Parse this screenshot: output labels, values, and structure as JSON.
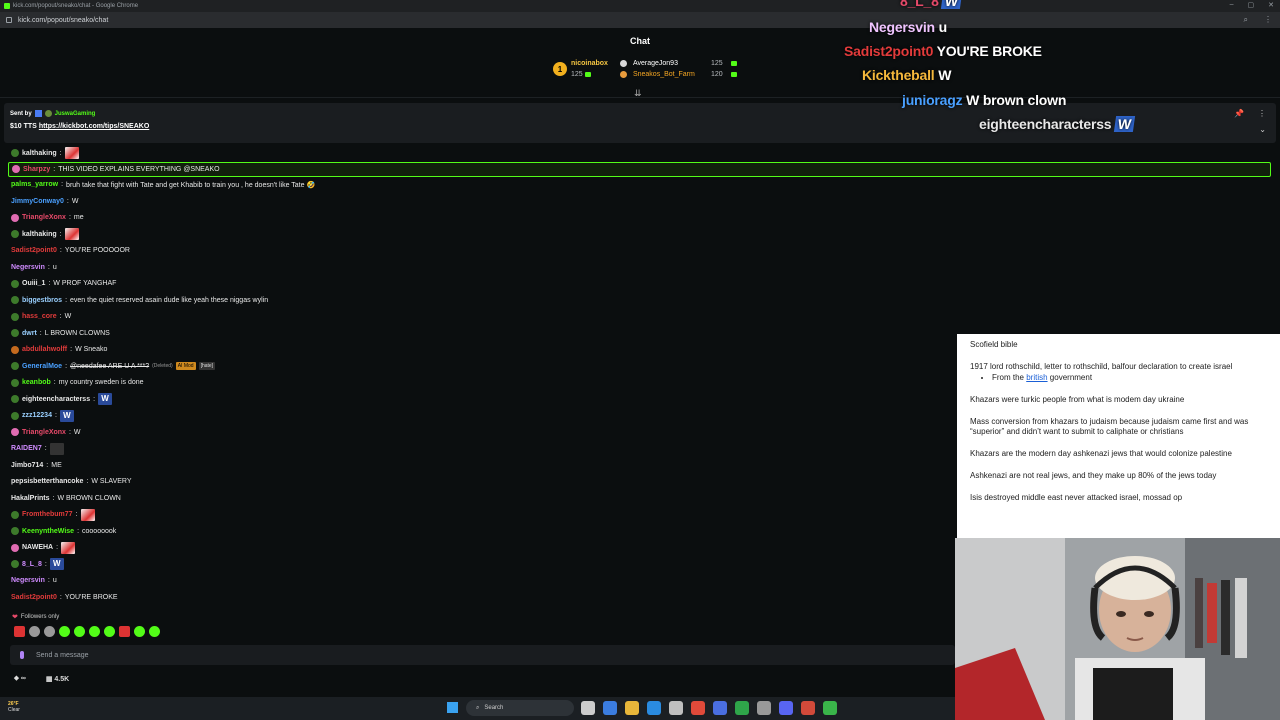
{
  "browser": {
    "title": "kick.com/popout/sneako/chat - Google Chrome",
    "url": "kick.com/popout/sneako/chat"
  },
  "chat": {
    "title": "Chat",
    "leaderboard_top": {
      "rank": "1",
      "name": "nicoinabox",
      "points": "125"
    },
    "leaderboard_rows": [
      {
        "name": "AverageJon93",
        "points": "125"
      },
      {
        "name": "Sneakos_Bot_Farm",
        "points": "120"
      }
    ],
    "pinned": {
      "sent_by_label": "Sent by",
      "user": "JuswaGaming",
      "text_prefix": "$10 TTS",
      "link": "https://kickbot.com/tips/SNEAKO"
    }
  },
  "messages": [
    {
      "user": "kalthaking",
      "color": "#e8e8e8",
      "text": "",
      "emote": "img",
      "badge": "green"
    },
    {
      "user": "Sharpzy",
      "color": "#e84a6a",
      "text": "THIS VIDEO EXPLAINS EVERYTHING @SNEAKO",
      "badge": "pink",
      "highlight": true
    },
    {
      "user": "palms_yarrow",
      "color": "#53fc18",
      "text": "bruh take that fight with Tate and get Khabib to train you , he doesn't like Tate 🤣"
    },
    {
      "user": "JimmyConway0",
      "color": "#4aa0ff",
      "text": "W"
    },
    {
      "user": "TriangleXonx",
      "color": "#e84a6a",
      "text": "me",
      "badge": "pink"
    },
    {
      "user": "kalthaking",
      "color": "#e8e8e8",
      "text": "",
      "emote": "img",
      "badge": "green"
    },
    {
      "user": "Sadist2point0",
      "color": "#e23b3b",
      "text": "YOU'RE POOOOOR"
    },
    {
      "user": "Negersvin",
      "color": "#d08cff",
      "text": "u"
    },
    {
      "user": "Ouiii_1",
      "color": "#e8e8e8",
      "text": "W PROF YANGHAF",
      "badge": "green"
    },
    {
      "user": "biggestbros",
      "color": "#9ad0ff",
      "text": "even the quiet reserved asain dude like yeah these niggas wylin",
      "badge": "green"
    },
    {
      "user": "hass_core",
      "color": "#e23b3b",
      "text": "W",
      "badge": "green"
    },
    {
      "user": "dwrt",
      "color": "#9ad0ff",
      "text": "L BROWN CLOWNS",
      "badge": "green"
    },
    {
      "user": "abdullahwolff",
      "color": "#e23b3b",
      "text": "W Sneako",
      "badge": "orange"
    },
    {
      "user": "GeneralMoe",
      "color": "#4aa0ff",
      "text": "@needafee ARE U A ***?",
      "deleted": "(Deleted)",
      "chip": "AI Mod",
      "chip2": "[hate]",
      "badge": "green"
    },
    {
      "user": "keanbob",
      "color": "#53fc18",
      "text": "my country sweden is done",
      "badge": "green"
    },
    {
      "user": "eighteencharacterss",
      "color": "#e8e8e8",
      "text": "",
      "emote": "w",
      "badge": "green"
    },
    {
      "user": "zzz12234",
      "color": "#9ad0ff",
      "text": "",
      "emote": "w",
      "badge": "green"
    },
    {
      "user": "TriangleXonx",
      "color": "#e84a6a",
      "text": "W",
      "badge": "pink"
    },
    {
      "user": "RAIDEN7",
      "color": "#d08cff",
      "text": "",
      "emote": "dark"
    },
    {
      "user": "Jimbo714",
      "color": "#e8e8e8",
      "text": "ME"
    },
    {
      "user": "pepsisbetterthancoke",
      "color": "#e8e8e8",
      "text": "W SLAVERY"
    },
    {
      "user": "HakalPrints",
      "color": "#e8e8e8",
      "text": "W BROWN CLOWN"
    },
    {
      "user": "Fromthebum77",
      "color": "#e23b3b",
      "text": "",
      "emote": "img",
      "badge": "green"
    },
    {
      "user": "KeenyntheWise",
      "color": "#53fc18",
      "text": "coooooook",
      "badge": "green"
    },
    {
      "user": "NAWEHA",
      "color": "#e8e8e8",
      "text": "",
      "emote": "img",
      "badge": "pink"
    },
    {
      "user": "8_L_8",
      "color": "#d08cff",
      "text": "",
      "emote": "w",
      "badge": "green"
    },
    {
      "user": "Negersvin",
      "color": "#d08cff",
      "text": "u"
    },
    {
      "user": "Sadist2point0",
      "color": "#e23b3b",
      "text": "YOU'RE BROKE"
    }
  ],
  "footer": {
    "followers_only": "Followers only",
    "input_placeholder": "Send a message",
    "viewers": "4.5K"
  },
  "overlay": {
    "lines": [
      {
        "user": "8_L_8",
        "color": "#e84a6a",
        "text": "",
        "w": "W"
      },
      {
        "user": "Negersvin",
        "color": "#f0c4ff",
        "text": "u"
      },
      {
        "user": "Sadist2point0",
        "color": "#e23b3b",
        "text": "YOU'RE BROKE"
      },
      {
        "user": "Kicktheball",
        "color": "#f5b83c",
        "text": "W"
      },
      {
        "user": "junioragz",
        "color": "#4aa0ff",
        "text": "W brown clown"
      },
      {
        "user": "eighteencharacterss",
        "color": "#e8e8e8",
        "text": "",
        "w": "W"
      }
    ]
  },
  "notes": {
    "title": "Scofield bible",
    "p1": "1917 lord rothschild, letter to rothschild, balfour declaration to create israel",
    "p1_bullet_prefix": "From the ",
    "p1_bullet_link": "british",
    "p1_bullet_suffix": " government",
    "p2": "Khazars were turkic people from what is modem day ukraine",
    "p3": "Mass conversion from khazars to judaism because judaism came first and was “superior” and didn’t want to submit to caliphate or christians",
    "p4": "Khazars are the modern day ashkenazi jews that would colonize palestine",
    "p5": "Ashkenazi are not real jews, and they make up 80% of the jews today",
    "p6": "Isis destroyed middle east never attacked israel, mossad op"
  },
  "taskbar": {
    "temp": "26°F",
    "weather": "Clear",
    "search_placeholder": "Search"
  },
  "colors": {
    "brand": "#53fc18",
    "bg": "#0b0e0f"
  }
}
